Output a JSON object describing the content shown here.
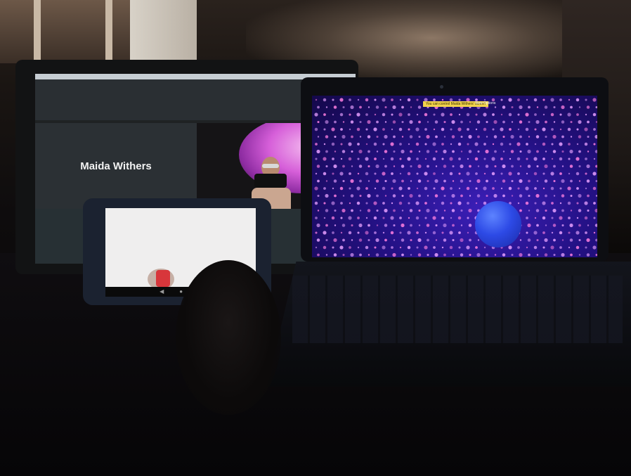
{
  "monitor": {
    "participant_name": "Maida Withers"
  },
  "laptop": {
    "notice_text": "You can control Maida Withers' screen",
    "view_options_label": "View Options"
  },
  "tablet": {
    "nav_back": "◀",
    "nav_home": "●",
    "nav_recent": "■"
  },
  "colors": {
    "laptop_visual_bg": "#241185",
    "sphere": "#2d4ae6",
    "notice_bar": "#f1d24b",
    "pink_accent": "#d65fd9",
    "tablet_phone": "#d8363b"
  }
}
